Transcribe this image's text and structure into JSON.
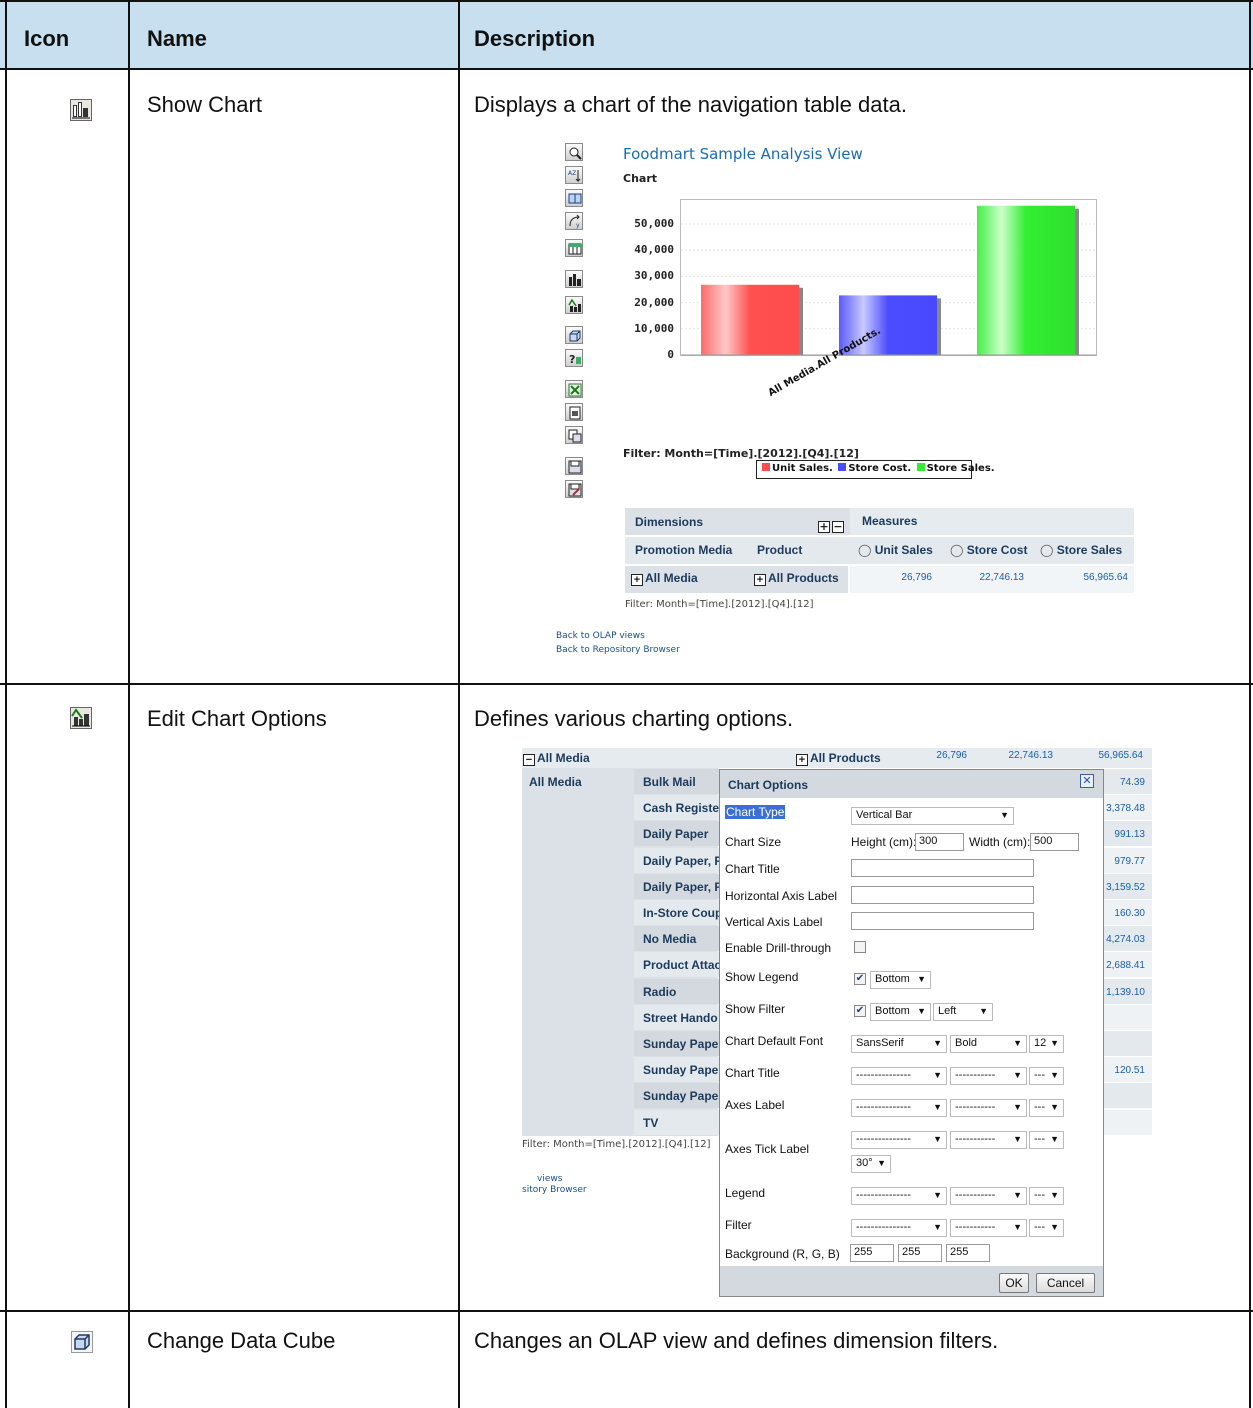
{
  "columns": {
    "icon": "Icon",
    "name": "Name",
    "description": "Description"
  },
  "rows": [
    {
      "icon": "show-chart-icon",
      "name": "Show Chart",
      "description": "Displays a chart of the navigation table data."
    },
    {
      "icon": "edit-chart-options-icon",
      "name": "Edit Chart Options",
      "description": "Defines various charting options."
    },
    {
      "icon": "change-data-cube-icon",
      "name": "Change Data Cube",
      "description": "Changes an OLAP view and defines dimension filters."
    }
  ],
  "shot1": {
    "title": "Foodmart Sample Analysis View",
    "subtitle": "Chart",
    "filter": "Filter: Month=[Time].[2012].[Q4].[12]",
    "legend": [
      "Unit Sales.",
      "Store Cost.",
      "Store Sales."
    ],
    "nav": {
      "dimensions": "Dimensions",
      "measures": "Measures",
      "promotion_media": "Promotion Media",
      "product": "Product",
      "unit_sales": "Unit Sales",
      "store_cost": "Store Cost",
      "store_sales": "Store Sales",
      "all_media": "All Media",
      "all_products": "All Products",
      "v1": "26,796",
      "v2": "22,746.13",
      "v3": "56,965.64"
    },
    "filter_below": "Filter: Month=[Time].[2012].[Q4].[12]",
    "link1": "Back to OLAP views",
    "link2": "Back to Repository Browser"
  },
  "chart_data": {
    "type": "bar",
    "categories": [
      "All Media.All Products."
    ],
    "series": [
      {
        "name": "Unit Sales.",
        "values": [
          26796
        ]
      },
      {
        "name": "Store Cost.",
        "values": [
          22746.13
        ]
      },
      {
        "name": "Store Sales.",
        "values": [
          56965.64
        ]
      }
    ],
    "yticks": [
      "0",
      "10,000",
      "20,000",
      "30,000",
      "40,000",
      "50,000"
    ],
    "ylim": [
      0,
      58000
    ],
    "colors": [
      "#ff5a5a",
      "#5a5aff",
      "#44ee44"
    ],
    "legend_position": "bottom"
  },
  "shot2": {
    "top": {
      "all_media": "All Media",
      "all_products": "All Products",
      "v1": "26,796",
      "v2": "22,746.13",
      "v3": "56,965.64"
    },
    "left_label": "All Media",
    "items": [
      "Bulk Mail",
      "Cash Register",
      "Daily Paper",
      "Daily Paper, R",
      "Daily Paper, R",
      "In-Store Coup",
      "No Media",
      "Product Attac",
      "Radio",
      "Street Hando",
      "Sunday Pape",
      "Sunday Pape",
      "Sunday Pape",
      "TV"
    ],
    "right_vals": [
      "74.39",
      "3,378.48",
      "991.13",
      "979.77",
      "3,159.52",
      "160.30",
      "4,274.03",
      "2,688.41",
      "1,139.10",
      "",
      "",
      "120.51",
      "",
      ""
    ],
    "filter": "Filter: Month=[Time].[2012].[Q4].[12]",
    "link1": "views",
    "link2": "sitory Browser",
    "dialog": {
      "title": "Chart Options",
      "chart_type_label": "Chart Type",
      "chart_type_value": "Vertical Bar",
      "chart_size_label": "Chart Size",
      "height_label": "Height (cm):",
      "height_value": "300",
      "width_label": "Width (cm):",
      "width_value": "500",
      "chart_title_label": "Chart Title",
      "h_axis_label": "Horizontal Axis Label",
      "v_axis_label": "Vertical Axis Label",
      "drill_label": "Enable Drill-through",
      "legend_label": "Show Legend",
      "legend_pos": "Bottom",
      "filter_label": "Show Filter",
      "filter_pos": "Bottom",
      "filter_align": "Left",
      "font_label": "Chart Default Font",
      "font_family": "SansSerif",
      "font_style": "Bold",
      "font_size": "12",
      "chart_title_label2": "Chart Title",
      "axes_label": "Axes Label",
      "axes_tick_label": "Axes Tick Label",
      "tick_angle": "30°",
      "legend_label2": "Legend",
      "filter_label2": "Filter",
      "bg_label": "Background (R, G, B)",
      "bg_r": "255",
      "bg_g": "255",
      "bg_b": "255",
      "dash_long": "---------------",
      "dash_mid": "-----------",
      "dash_short": "---",
      "ok": "OK",
      "cancel": "Cancel"
    }
  }
}
